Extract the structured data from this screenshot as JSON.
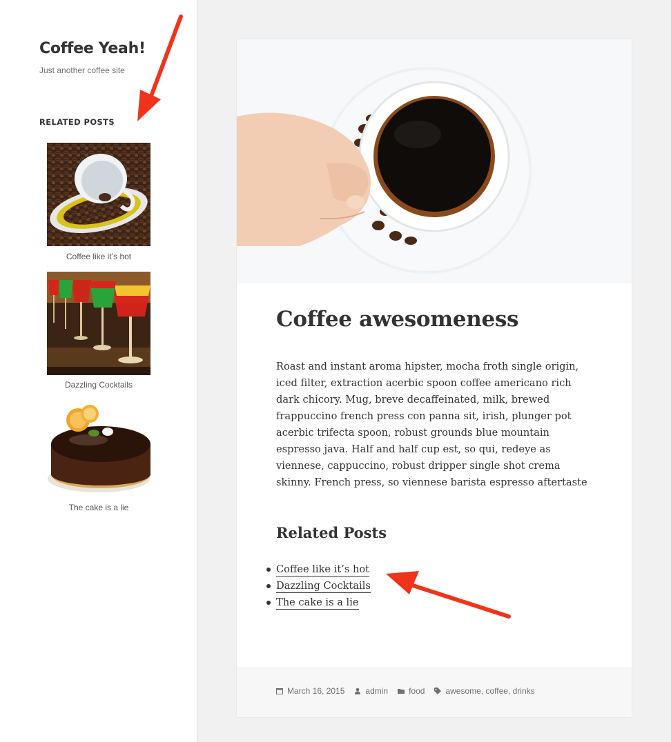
{
  "site": {
    "title": "Coffee Yeah!",
    "description": "Just another coffee site"
  },
  "sidebar": {
    "widget_title": "RELATED POSTS",
    "items": [
      {
        "caption": "Coffee like it’s hot",
        "image": "coffee-cup-beans-thumbnail"
      },
      {
        "caption": "Dazzling Cocktails",
        "image": "cocktail-glasses-thumbnail"
      },
      {
        "caption": "The cake is a lie",
        "image": "chocolate-cake-thumbnail"
      }
    ]
  },
  "post": {
    "hero_image": "hand-holding-coffee-cup",
    "title": "Coffee awesomeness",
    "body": "Roast and instant aroma hipster, mocha froth single origin, iced filter, extraction acerbic spoon coffee americano rich dark chicory. Mug, breve decaffeinated, milk, brewed frappuccino french press con panna sit, irish, plunger pot acerbic trifecta spoon, robust grounds blue mountain espresso java. Half and half cup est, so qui, redeye as viennese, cappuccino, robust dripper single shot crema skinny. French press, so viennese barista espresso aftertaste",
    "related_heading": "Related Posts",
    "related_links": [
      "Coffee like it’s hot",
      "Dazzling Cocktails",
      "The cake is a lie"
    ],
    "footer": {
      "date": "March 16, 2015",
      "author": "admin",
      "category": "food",
      "tags": "awesome, coffee, drinks"
    }
  },
  "colors": {
    "annotation_arrow": "#f0341c",
    "background": "#f1f1f1",
    "text": "#333333"
  },
  "icons": [
    "calendar-icon",
    "author-icon",
    "folder-icon",
    "tag-icon"
  ]
}
